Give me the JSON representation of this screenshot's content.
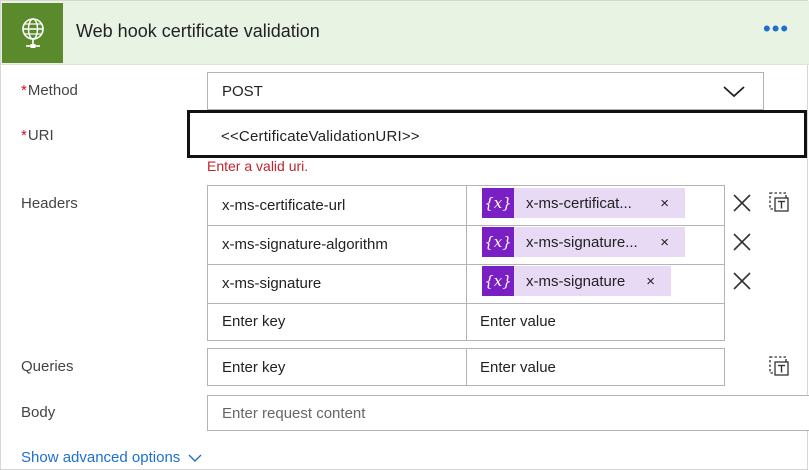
{
  "header": {
    "title": "Web hook certificate validation",
    "more_label": "•••"
  },
  "method": {
    "label": "Method",
    "required_mark": "*",
    "value": "POST"
  },
  "uri": {
    "label": "URI",
    "required_mark": "*",
    "value": "<<CertificateValidationURI>>",
    "error": "Enter a valid uri."
  },
  "headers": {
    "label": "Headers",
    "rows": [
      {
        "key": "x-ms-certificate-url",
        "token_icon": "{x}",
        "token_text": "x-ms-certificat...",
        "remove": "×"
      },
      {
        "key": "x-ms-signature-algorithm",
        "token_icon": "{x}",
        "token_text": "x-ms-signature...",
        "remove": "×"
      },
      {
        "key": "x-ms-signature",
        "token_icon": "{x}",
        "token_text": "x-ms-signature",
        "remove": "×"
      }
    ],
    "key_placeholder": "Enter key",
    "value_placeholder": "Enter value"
  },
  "queries": {
    "label": "Queries",
    "key_placeholder": "Enter key",
    "value_placeholder": "Enter value"
  },
  "body": {
    "label": "Body",
    "placeholder": "Enter request content"
  },
  "advanced": {
    "label": "Show advanced options"
  },
  "colors": {
    "accent_green": "#5b8a2d",
    "header_bg": "#e8f3e4",
    "link_blue": "#1e6fcf",
    "token_purple": "#7a1fc4",
    "token_bg": "#e8d9f5",
    "error_red": "#c0262d"
  }
}
